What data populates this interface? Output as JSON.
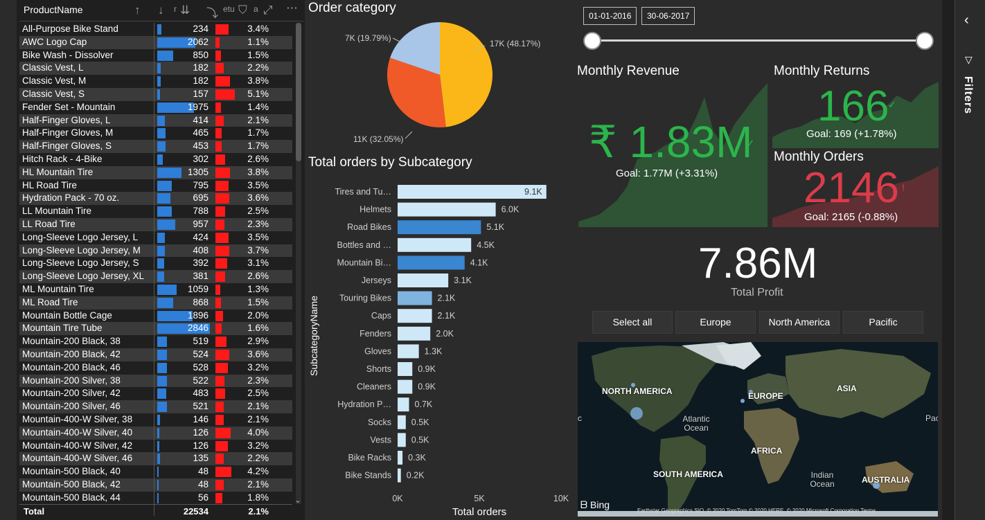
{
  "table": {
    "header": {
      "product_name": "ProductName",
      "truncated_1": "r",
      "truncated_2": "etu",
      "truncated_3": "a"
    },
    "rows": [
      {
        "name": "All-Purpose Bike Stand",
        "qty": "234",
        "qty_value": 234,
        "rate": "3.4%",
        "rate_value": 3.4
      },
      {
        "name": "AWC Logo Cap",
        "qty": "2062",
        "qty_value": 2062,
        "rate": "1.1%",
        "rate_value": 1.1
      },
      {
        "name": "Bike Wash - Dissolver",
        "qty": "850",
        "qty_value": 850,
        "rate": "1.5%",
        "rate_value": 1.5
      },
      {
        "name": "Classic Vest, L",
        "qty": "182",
        "qty_value": 182,
        "rate": "2.2%",
        "rate_value": 2.2
      },
      {
        "name": "Classic Vest, M",
        "qty": "182",
        "qty_value": 182,
        "rate": "3.8%",
        "rate_value": 3.8
      },
      {
        "name": "Classic Vest, S",
        "qty": "157",
        "qty_value": 157,
        "rate": "5.1%",
        "rate_value": 5.1
      },
      {
        "name": "Fender Set - Mountain",
        "qty": "1975",
        "qty_value": 1975,
        "rate": "1.4%",
        "rate_value": 1.4
      },
      {
        "name": "Half-Finger Gloves, L",
        "qty": "414",
        "qty_value": 414,
        "rate": "2.1%",
        "rate_value": 2.1
      },
      {
        "name": "Half-Finger Gloves, M",
        "qty": "465",
        "qty_value": 465,
        "rate": "1.7%",
        "rate_value": 1.7
      },
      {
        "name": "Half-Finger Gloves, S",
        "qty": "453",
        "qty_value": 453,
        "rate": "1.7%",
        "rate_value": 1.7
      },
      {
        "name": "Hitch Rack - 4-Bike",
        "qty": "302",
        "qty_value": 302,
        "rate": "2.6%",
        "rate_value": 2.6
      },
      {
        "name": "HL Mountain Tire",
        "qty": "1305",
        "qty_value": 1305,
        "rate": "3.8%",
        "rate_value": 3.8
      },
      {
        "name": "HL Road Tire",
        "qty": "795",
        "qty_value": 795,
        "rate": "3.5%",
        "rate_value": 3.5
      },
      {
        "name": "Hydration Pack - 70 oz.",
        "qty": "695",
        "qty_value": 695,
        "rate": "3.6%",
        "rate_value": 3.6
      },
      {
        "name": "LL Mountain Tire",
        "qty": "788",
        "qty_value": 788,
        "rate": "2.5%",
        "rate_value": 2.5
      },
      {
        "name": "LL Road Tire",
        "qty": "957",
        "qty_value": 957,
        "rate": "2.3%",
        "rate_value": 2.3
      },
      {
        "name": "Long-Sleeve Logo Jersey, L",
        "qty": "424",
        "qty_value": 424,
        "rate": "3.5%",
        "rate_value": 3.5
      },
      {
        "name": "Long-Sleeve Logo Jersey, M",
        "qty": "408",
        "qty_value": 408,
        "rate": "3.7%",
        "rate_value": 3.7
      },
      {
        "name": "Long-Sleeve Logo Jersey, S",
        "qty": "392",
        "qty_value": 392,
        "rate": "3.1%",
        "rate_value": 3.1
      },
      {
        "name": "Long-Sleeve Logo Jersey, XL",
        "qty": "381",
        "qty_value": 381,
        "rate": "2.6%",
        "rate_value": 2.6
      },
      {
        "name": "ML Mountain Tire",
        "qty": "1059",
        "qty_value": 1059,
        "rate": "1.3%",
        "rate_value": 1.3
      },
      {
        "name": "ML Road Tire",
        "qty": "868",
        "qty_value": 868,
        "rate": "1.5%",
        "rate_value": 1.5
      },
      {
        "name": "Mountain Bottle Cage",
        "qty": "1896",
        "qty_value": 1896,
        "rate": "2.0%",
        "rate_value": 2.0
      },
      {
        "name": "Mountain Tire Tube",
        "qty": "2846",
        "qty_value": 2846,
        "rate": "1.6%",
        "rate_value": 1.6
      },
      {
        "name": "Mountain-200 Black, 38",
        "qty": "519",
        "qty_value": 519,
        "rate": "2.9%",
        "rate_value": 2.9
      },
      {
        "name": "Mountain-200 Black, 42",
        "qty": "524",
        "qty_value": 524,
        "rate": "3.6%",
        "rate_value": 3.6
      },
      {
        "name": "Mountain-200 Black, 46",
        "qty": "528",
        "qty_value": 528,
        "rate": "3.2%",
        "rate_value": 3.2
      },
      {
        "name": "Mountain-200 Silver, 38",
        "qty": "522",
        "qty_value": 522,
        "rate": "2.3%",
        "rate_value": 2.3
      },
      {
        "name": "Mountain-200 Silver, 42",
        "qty": "483",
        "qty_value": 483,
        "rate": "2.5%",
        "rate_value": 2.5
      },
      {
        "name": "Mountain-200 Silver, 46",
        "qty": "521",
        "qty_value": 521,
        "rate": "2.1%",
        "rate_value": 2.1
      },
      {
        "name": "Mountain-400-W Silver, 38",
        "qty": "146",
        "qty_value": 146,
        "rate": "2.1%",
        "rate_value": 2.1
      },
      {
        "name": "Mountain-400-W Silver, 40",
        "qty": "126",
        "qty_value": 126,
        "rate": "4.0%",
        "rate_value": 4.0
      },
      {
        "name": "Mountain-400-W Silver, 42",
        "qty": "126",
        "qty_value": 126,
        "rate": "3.2%",
        "rate_value": 3.2
      },
      {
        "name": "Mountain-400-W Silver, 46",
        "qty": "135",
        "qty_value": 135,
        "rate": "2.2%",
        "rate_value": 2.2
      },
      {
        "name": "Mountain-500 Black, 40",
        "qty": "48",
        "qty_value": 48,
        "rate": "4.2%",
        "rate_value": 4.2
      },
      {
        "name": "Mountain-500 Black, 42",
        "qty": "48",
        "qty_value": 48,
        "rate": "2.1%",
        "rate_value": 2.1
      },
      {
        "name": "Mountain-500 Black, 44",
        "qty": "56",
        "qty_value": 56,
        "rate": "1.8%",
        "rate_value": 1.8
      }
    ],
    "total": {
      "label": "Total",
      "qty": "22534",
      "rate": "2.1%"
    }
  },
  "order_category": {
    "title": "Order category",
    "slices": [
      {
        "label": "17K (48.17%)",
        "value": 48.17,
        "color": "#fbb718"
      },
      {
        "label": "11K (32.05%)",
        "value": 32.05,
        "color": "#f05a28"
      },
      {
        "label": "7K (19.79%)",
        "value": 19.79,
        "color": "#a9c6e8"
      }
    ]
  },
  "chart_data": {
    "type": "bar",
    "orientation": "horizontal",
    "title": "Total orders by Subcategory",
    "xlabel": "Total orders",
    "ylabel": "SubcategoryName",
    "xlim": [
      0,
      10000
    ],
    "xticks": [
      "0K",
      "5K",
      "10K"
    ],
    "categories": [
      "Tires and Tu…",
      "Helmets",
      "Road Bikes",
      "Bottles and …",
      "Mountain Bi…",
      "Jerseys",
      "Touring Bikes",
      "Caps",
      "Fenders",
      "Gloves",
      "Shorts",
      "Cleaners",
      "Hydration P…",
      "Socks",
      "Vests",
      "Bike Racks",
      "Bike Stands"
    ],
    "values": [
      9100,
      6000,
      5100,
      4500,
      4100,
      3100,
      2100,
      2100,
      2000,
      1300,
      900,
      900,
      700,
      500,
      500,
      300,
      200
    ],
    "value_labels": [
      "9.1K",
      "6.0K",
      "5.1K",
      "4.5K",
      "4.1K",
      "3.1K",
      "2.1K",
      "2.1K",
      "2.0K",
      "1.3K",
      "0.9K",
      "0.9K",
      "0.7K",
      "0.5K",
      "0.5K",
      "0.3K",
      "0.2K"
    ],
    "colors": [
      "#cfe8f7",
      "#cfe8f7",
      "#3a86d0",
      "#cfe8f7",
      "#3a86d0",
      "#cfe8f7",
      "#7fb3e0",
      "#cfe8f7",
      "#cfe8f7",
      "#cfe8f7",
      "#cfe8f7",
      "#cfe8f7",
      "#cfe8f7",
      "#cfe8f7",
      "#cfe8f7",
      "#cfe8f7",
      "#cfe8f7"
    ]
  },
  "date_slicer": {
    "start": "01-01-2016",
    "end": "30-06-2017"
  },
  "kpis": {
    "revenue": {
      "title": "Monthly Revenue",
      "value": "₹ 1.83M",
      "goal": "Goal: 1.77M (+3.31%)",
      "status_icon": "check-icon"
    },
    "returns": {
      "title": "Monthly Returns",
      "value": "166",
      "goal": "Goal: 169 (+1.78%)",
      "status_icon": "check-icon"
    },
    "orders": {
      "title": "Monthly Orders",
      "value": "2146",
      "goal": "Goal: 2165 (-0.88%)",
      "status_icon": "exclamation-icon"
    },
    "profit": {
      "value": "7.86M",
      "label": "Total Profit"
    }
  },
  "region_slicer": [
    "Select all",
    "Europe",
    "North America",
    "Pacific"
  ],
  "map": {
    "labels": {
      "north_america": "NORTH AMERICA",
      "europe": "EUROPE",
      "asia": "ASIA",
      "atlantic": "Atlantic Ocean",
      "africa": "AFRICA",
      "south_america": "SOUTH AMERICA",
      "indian": "Indian Ocean",
      "australia": "AUSTRALIA",
      "pacific_left": "c",
      "pacific_right": "Pac"
    },
    "bing": "Bing",
    "attribution": "Earthstar Geographics SIO, © 2020 TomTom © 2020 HERE, © 2020 Microsoft Corporation  Terms"
  },
  "filters_pane": {
    "label": "Filters"
  }
}
